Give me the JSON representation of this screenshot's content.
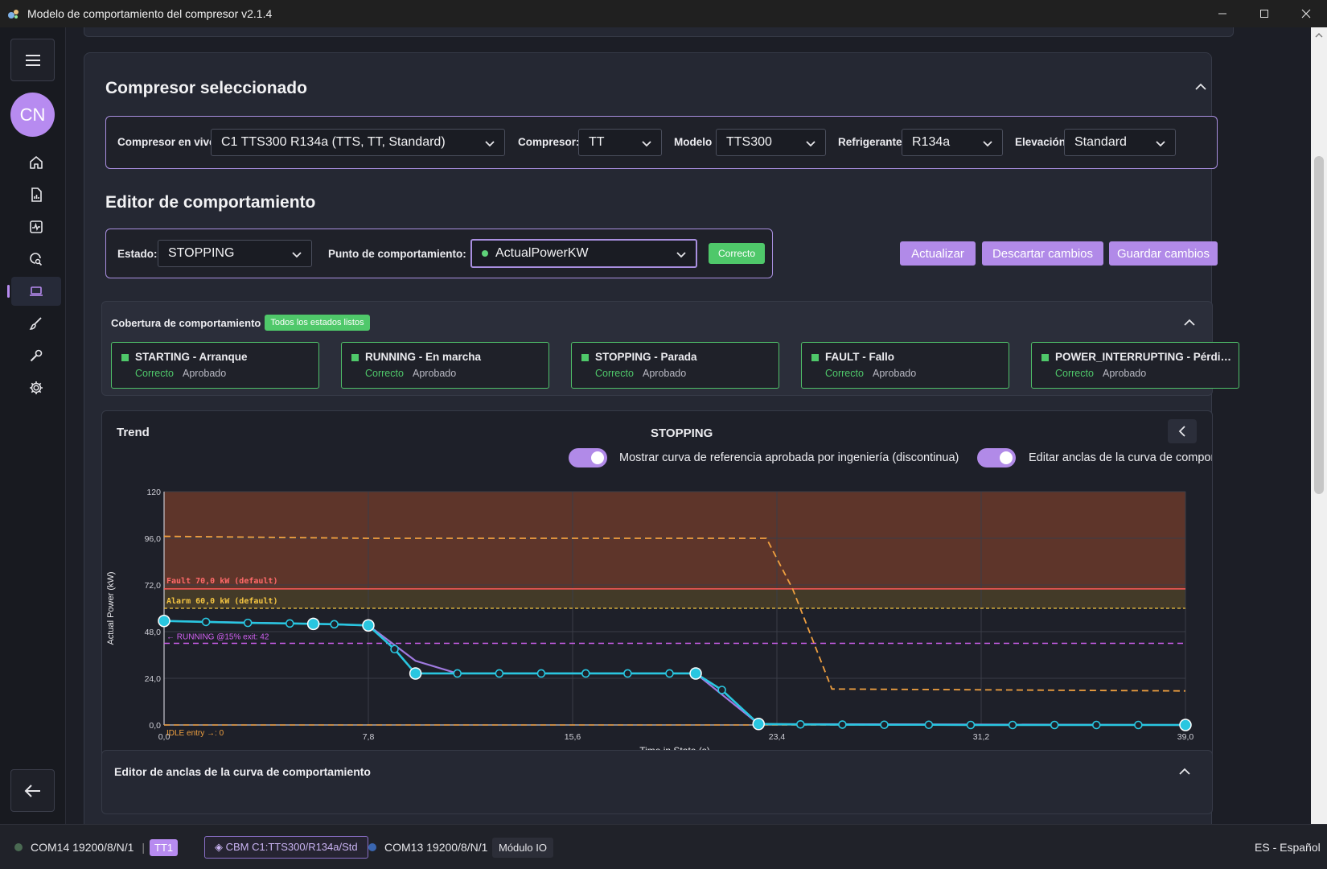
{
  "window": {
    "title": "Modelo de comportamiento del compresor v2.1.4"
  },
  "sidebar": {
    "avatar_initials": "CN"
  },
  "selected_compressor": {
    "heading": "Compresor seleccionado",
    "live_label": "Compresor en vivo",
    "live_value": "C1  TTS300 R134a (TTS, TT, Standard)",
    "compressor_label": "Compresor:",
    "compressor_value": "TT",
    "model_label": "Modelo",
    "model_value": "TTS300",
    "refrigerant_label": "Refrigerante",
    "refrigerant_value": "R134a",
    "elevation_label": "Elevación",
    "elevation_value": "Standard"
  },
  "behavior_editor": {
    "heading": "Editor de comportamiento",
    "state_label": "Estado:",
    "state_value": "STOPPING",
    "point_label": "Punto de comportamiento:",
    "point_value": "ActualPowerKW",
    "point_status": "Correcto",
    "btn_update": "Actualizar",
    "btn_discard": "Descartar cambios",
    "btn_save": "Guardar cambios"
  },
  "coverage": {
    "title": "Cobertura de comportamiento",
    "badge": "Todos los estados listos",
    "cards": [
      {
        "title": "STARTING - Arranque",
        "status": "Correcto",
        "approval": "Aprobado"
      },
      {
        "title": "RUNNING - En marcha",
        "status": "Correcto",
        "approval": "Aprobado"
      },
      {
        "title": "STOPPING - Parada",
        "status": "Correcto",
        "approval": "Aprobado"
      },
      {
        "title": "FAULT - Fallo",
        "status": "Correcto",
        "approval": "Aprobado"
      },
      {
        "title": "POWER_INTERRUPTING - Pérdida d...",
        "status": "Correcto",
        "approval": "Aprobado"
      }
    ]
  },
  "trend": {
    "title": "Trend",
    "state": "STOPPING",
    "toggle1_label": "Mostrar curva de referencia aprobada por ingeniería (discontinua)",
    "toggle2_label": "Editar anclas de la curva de comportamien"
  },
  "anchors_editor": {
    "title": "Editor de anclas de la curva de comportamiento"
  },
  "statusbar": {
    "port1": "COM14 19200/8/N/1",
    "sep": "|",
    "tag1": "TT1",
    "tag2": "◈ CBM C1:TTS300/R134a/Std",
    "port2": "COM13 19200/8/N/1",
    "module": "Módulo IO",
    "language": "ES - Español"
  },
  "colors": {
    "accent": "#b78bf0",
    "ok_green": "#4fc86a",
    "fault_red": "#ff5a5a",
    "alarm_yellow": "#f5c542",
    "curve_cyan": "#29c6e0",
    "reference_orange": "#f0a040",
    "running_magenta": "#d060f0"
  },
  "chart_data": {
    "type": "line",
    "title": "",
    "xlabel": "Time in State (s)",
    "ylabel": "Actual Power (kW)",
    "xlim": [
      0,
      39
    ],
    "ylim": [
      0,
      120
    ],
    "x_ticks": [
      "0,0",
      "7,8",
      "15,6",
      "23,4",
      "31,2",
      "39,0"
    ],
    "y_ticks": [
      "0,0",
      "24,0",
      "48,0",
      "72,0",
      "96,0",
      "120"
    ],
    "grid": true,
    "thresholds": [
      {
        "name": "Fault",
        "label": "Fault  70,0 kW  (default)",
        "value": 70,
        "color": "#ff5a5a"
      },
      {
        "name": "Alarm",
        "label": "Alarm  60,0 kW  (default)",
        "value": 60,
        "color": "#f5c542"
      }
    ],
    "running_marker": {
      "label": "← RUNNING @15% exit: 42",
      "value": 42
    },
    "idle_marker": {
      "label": "IDLE entry →: 0",
      "value": 0
    },
    "series": [
      {
        "role": "curve",
        "x": [
          0,
          1.6,
          3.2,
          4.8,
          5.7,
          6.5,
          7.8,
          8.8,
          9.6,
          11.2,
          12.8,
          14.4,
          16.1,
          17.7,
          19.3,
          20.3,
          21.3,
          22.7,
          24.3,
          25.9,
          27.5,
          29.2,
          30.8,
          32.4,
          34.0,
          35.6,
          37.2,
          39.0
        ],
        "y": [
          53.5,
          53.0,
          52.5,
          52.2,
          52.0,
          51.8,
          51.2,
          39.0,
          26.5,
          26.5,
          26.5,
          26.5,
          26.5,
          26.5,
          26.5,
          26.5,
          18.0,
          0.5,
          0.3,
          0.2,
          0.1,
          0.1,
          0.0,
          0.0,
          0.0,
          0.0,
          0.0,
          0.0
        ]
      },
      {
        "role": "editable-curve",
        "x": [
          0,
          5.7,
          7.8,
          9.6,
          11.2,
          20.3,
          22.7,
          39.0
        ],
        "y": [
          53.5,
          52.0,
          51.2,
          33.0,
          26.5,
          26.5,
          0.5,
          0.0
        ]
      },
      {
        "role": "reference",
        "x": [
          0,
          7.8,
          15.6,
          23.0,
          24.0,
          25.5,
          39.0
        ],
        "y": [
          97.0,
          96.0,
          96.0,
          96.0,
          70.0,
          18.5,
          17.5
        ]
      }
    ],
    "anchors_x": [
      0,
      5.7,
      7.8,
      9.6,
      20.3,
      22.7,
      39.0
    ]
  }
}
